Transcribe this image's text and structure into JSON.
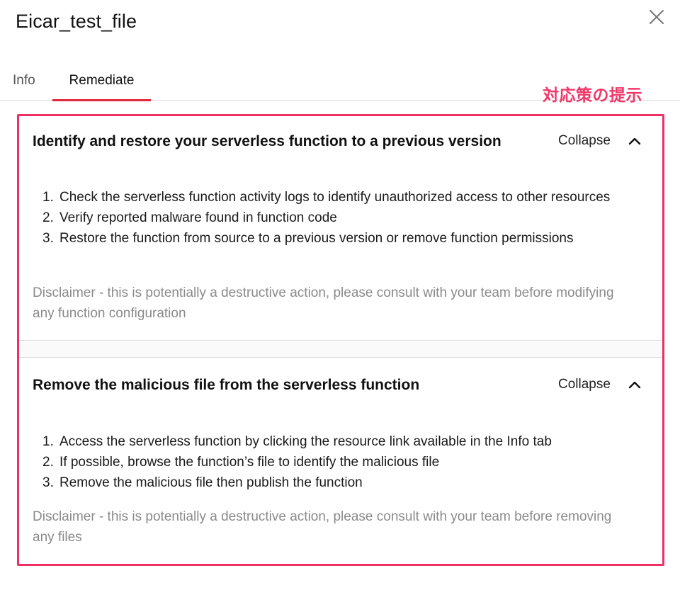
{
  "header": {
    "title": "Eicar_test_file",
    "close_icon": "close-icon"
  },
  "tabs": [
    {
      "label": "Info",
      "active": false
    },
    {
      "label": "Remediate",
      "active": true
    }
  ],
  "annotation": {
    "text": "対応策の提示",
    "color": "#ef2e68"
  },
  "colors": {
    "accent_tab": "#e0283a",
    "highlight_frame": "#ef2e68",
    "disclaimer_text": "#8a8a8a"
  },
  "sections": [
    {
      "title": "Identify and restore your serverless function to a previous version",
      "collapse_label": "Collapse",
      "icon": "chevron-up-icon",
      "steps": [
        {
          "num": "1.",
          "text": "Check the serverless function activity logs to identify unauthorized access to other resources"
        },
        {
          "num": "2.",
          "text": "Verify reported malware found in function code"
        },
        {
          "num": "3.",
          "text": "Restore the function from source to a previous version or remove function permissions"
        }
      ],
      "disclaimer": "Disclaimer - this is potentially a destructive action, please consult with your team before modifying any function configuration"
    },
    {
      "title": "Remove the malicious file from the serverless function",
      "collapse_label": "Collapse",
      "icon": "chevron-up-icon",
      "steps": [
        {
          "num": "1.",
          "text": "Access the serverless function by clicking the resource link available in the Info tab"
        },
        {
          "num": "2.",
          "text": "If possible, browse the function’s file to identify the malicious file"
        },
        {
          "num": "3.",
          "text": "Remove the malicious file then publish the function"
        }
      ],
      "disclaimer": "Disclaimer - this is potentially a destructive action, please consult with your team before removing any files"
    }
  ]
}
